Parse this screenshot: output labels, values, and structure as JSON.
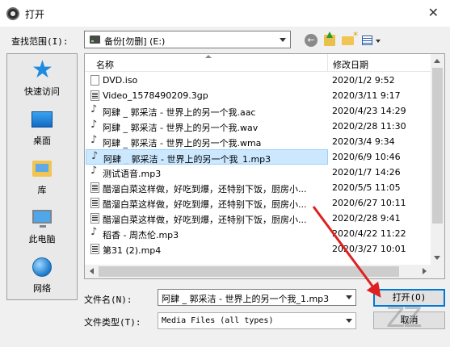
{
  "titlebar": {
    "title": "打开",
    "close_glyph": "✕"
  },
  "toolbar": {
    "lookin_label": "查找范围(I):",
    "lookin_value": "备份[勿删] (E:)",
    "back_glyph": "←"
  },
  "places": [
    {
      "label": "快速访问"
    },
    {
      "label": "桌面"
    },
    {
      "label": "库"
    },
    {
      "label": "此电脑"
    },
    {
      "label": "网络"
    }
  ],
  "filelist": {
    "columns": {
      "name": "名称",
      "date": "修改日期"
    },
    "rows": [
      {
        "name": "DVD.iso",
        "date": "2020/1/2 9:52",
        "type": "file"
      },
      {
        "name": "Video_1578490209.3gp",
        "date": "2020/3/11 9:17",
        "type": "video"
      },
      {
        "name": "阿肆 _ 郭采洁 - 世界上的另一个我.aac",
        "date": "2020/4/23 14:29",
        "type": "audio"
      },
      {
        "name": "阿肆 _ 郭采洁 - 世界上的另一个我.wav",
        "date": "2020/2/28 11:30",
        "type": "audio"
      },
      {
        "name": "阿肆 _ 郭采洁 - 世界上的另一个我.wma",
        "date": "2020/3/4 9:34",
        "type": "audio"
      },
      {
        "name": "阿肆 _ 郭采洁 - 世界上的另一个我_1.mp3",
        "date": "2020/6/9 10:46",
        "type": "audio"
      },
      {
        "name": "测试语音.mp3",
        "date": "2020/1/7 14:26",
        "type": "audio"
      },
      {
        "name": "醋溜白菜这样做，好吃到爆，还特别下饭，厨房小...",
        "date": "2020/5/5 11:05",
        "type": "video"
      },
      {
        "name": "醋溜白菜这样做，好吃到爆，还特别下饭，厨房小...",
        "date": "2020/6/27 10:11",
        "type": "video"
      },
      {
        "name": "醋溜白菜这样做，好吃到爆，还特别下饭，厨房小...",
        "date": "2020/2/28 9:41",
        "type": "video"
      },
      {
        "name": "稻香 - 周杰伦.mp3",
        "date": "2020/4/22 11:22",
        "type": "audio"
      },
      {
        "name": "第31 (2).mp4",
        "date": "2020/3/27 10:01",
        "type": "video"
      }
    ],
    "selected_index": 5
  },
  "form": {
    "filename_label": "文件名(N):",
    "filename_value": "阿肆 _ 郭采洁 - 世界上的另一个我_1.mp3",
    "filetype_label": "文件类型(T):",
    "filetype_value": "Media Files (all types)"
  },
  "buttons": {
    "open": "打开(O)",
    "cancel": "取消"
  },
  "annotation_color": "#e02020",
  "selection_color": "#cce8ff",
  "accent_color": "#0078d7",
  "watermark": "ZZ"
}
